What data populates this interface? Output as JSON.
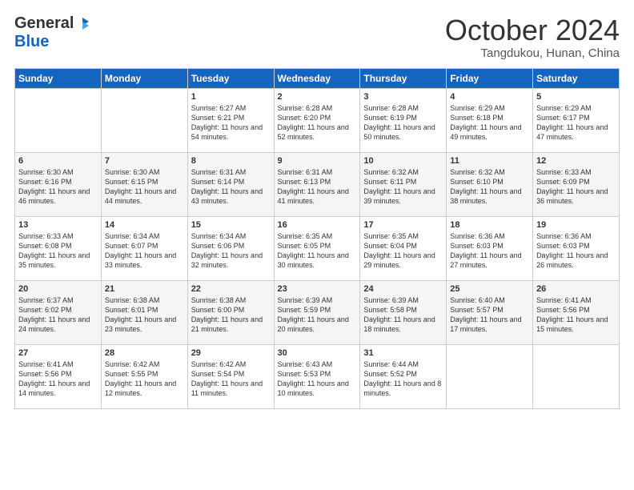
{
  "header": {
    "logo_general": "General",
    "logo_blue": "Blue",
    "title": "October 2024",
    "location": "Tangdukou, Hunan, China"
  },
  "days_of_week": [
    "Sunday",
    "Monday",
    "Tuesday",
    "Wednesday",
    "Thursday",
    "Friday",
    "Saturday"
  ],
  "weeks": [
    [
      {
        "day": "",
        "sunrise": "",
        "sunset": "",
        "daylight": ""
      },
      {
        "day": "",
        "sunrise": "",
        "sunset": "",
        "daylight": ""
      },
      {
        "day": "1",
        "sunrise": "Sunrise: 6:27 AM",
        "sunset": "Sunset: 6:21 PM",
        "daylight": "Daylight: 11 hours and 54 minutes."
      },
      {
        "day": "2",
        "sunrise": "Sunrise: 6:28 AM",
        "sunset": "Sunset: 6:20 PM",
        "daylight": "Daylight: 11 hours and 52 minutes."
      },
      {
        "day": "3",
        "sunrise": "Sunrise: 6:28 AM",
        "sunset": "Sunset: 6:19 PM",
        "daylight": "Daylight: 11 hours and 50 minutes."
      },
      {
        "day": "4",
        "sunrise": "Sunrise: 6:29 AM",
        "sunset": "Sunset: 6:18 PM",
        "daylight": "Daylight: 11 hours and 49 minutes."
      },
      {
        "day": "5",
        "sunrise": "Sunrise: 6:29 AM",
        "sunset": "Sunset: 6:17 PM",
        "daylight": "Daylight: 11 hours and 47 minutes."
      }
    ],
    [
      {
        "day": "6",
        "sunrise": "Sunrise: 6:30 AM",
        "sunset": "Sunset: 6:16 PM",
        "daylight": "Daylight: 11 hours and 46 minutes."
      },
      {
        "day": "7",
        "sunrise": "Sunrise: 6:30 AM",
        "sunset": "Sunset: 6:15 PM",
        "daylight": "Daylight: 11 hours and 44 minutes."
      },
      {
        "day": "8",
        "sunrise": "Sunrise: 6:31 AM",
        "sunset": "Sunset: 6:14 PM",
        "daylight": "Daylight: 11 hours and 43 minutes."
      },
      {
        "day": "9",
        "sunrise": "Sunrise: 6:31 AM",
        "sunset": "Sunset: 6:13 PM",
        "daylight": "Daylight: 11 hours and 41 minutes."
      },
      {
        "day": "10",
        "sunrise": "Sunrise: 6:32 AM",
        "sunset": "Sunset: 6:11 PM",
        "daylight": "Daylight: 11 hours and 39 minutes."
      },
      {
        "day": "11",
        "sunrise": "Sunrise: 6:32 AM",
        "sunset": "Sunset: 6:10 PM",
        "daylight": "Daylight: 11 hours and 38 minutes."
      },
      {
        "day": "12",
        "sunrise": "Sunrise: 6:33 AM",
        "sunset": "Sunset: 6:09 PM",
        "daylight": "Daylight: 11 hours and 36 minutes."
      }
    ],
    [
      {
        "day": "13",
        "sunrise": "Sunrise: 6:33 AM",
        "sunset": "Sunset: 6:08 PM",
        "daylight": "Daylight: 11 hours and 35 minutes."
      },
      {
        "day": "14",
        "sunrise": "Sunrise: 6:34 AM",
        "sunset": "Sunset: 6:07 PM",
        "daylight": "Daylight: 11 hours and 33 minutes."
      },
      {
        "day": "15",
        "sunrise": "Sunrise: 6:34 AM",
        "sunset": "Sunset: 6:06 PM",
        "daylight": "Daylight: 11 hours and 32 minutes."
      },
      {
        "day": "16",
        "sunrise": "Sunrise: 6:35 AM",
        "sunset": "Sunset: 6:05 PM",
        "daylight": "Daylight: 11 hours and 30 minutes."
      },
      {
        "day": "17",
        "sunrise": "Sunrise: 6:35 AM",
        "sunset": "Sunset: 6:04 PM",
        "daylight": "Daylight: 11 hours and 29 minutes."
      },
      {
        "day": "18",
        "sunrise": "Sunrise: 6:36 AM",
        "sunset": "Sunset: 6:03 PM",
        "daylight": "Daylight: 11 hours and 27 minutes."
      },
      {
        "day": "19",
        "sunrise": "Sunrise: 6:36 AM",
        "sunset": "Sunset: 6:03 PM",
        "daylight": "Daylight: 11 hours and 26 minutes."
      }
    ],
    [
      {
        "day": "20",
        "sunrise": "Sunrise: 6:37 AM",
        "sunset": "Sunset: 6:02 PM",
        "daylight": "Daylight: 11 hours and 24 minutes."
      },
      {
        "day": "21",
        "sunrise": "Sunrise: 6:38 AM",
        "sunset": "Sunset: 6:01 PM",
        "daylight": "Daylight: 11 hours and 23 minutes."
      },
      {
        "day": "22",
        "sunrise": "Sunrise: 6:38 AM",
        "sunset": "Sunset: 6:00 PM",
        "daylight": "Daylight: 11 hours and 21 minutes."
      },
      {
        "day": "23",
        "sunrise": "Sunrise: 6:39 AM",
        "sunset": "Sunset: 5:59 PM",
        "daylight": "Daylight: 11 hours and 20 minutes."
      },
      {
        "day": "24",
        "sunrise": "Sunrise: 6:39 AM",
        "sunset": "Sunset: 5:58 PM",
        "daylight": "Daylight: 11 hours and 18 minutes."
      },
      {
        "day": "25",
        "sunrise": "Sunrise: 6:40 AM",
        "sunset": "Sunset: 5:57 PM",
        "daylight": "Daylight: 11 hours and 17 minutes."
      },
      {
        "day": "26",
        "sunrise": "Sunrise: 6:41 AM",
        "sunset": "Sunset: 5:56 PM",
        "daylight": "Daylight: 11 hours and 15 minutes."
      }
    ],
    [
      {
        "day": "27",
        "sunrise": "Sunrise: 6:41 AM",
        "sunset": "Sunset: 5:56 PM",
        "daylight": "Daylight: 11 hours and 14 minutes."
      },
      {
        "day": "28",
        "sunrise": "Sunrise: 6:42 AM",
        "sunset": "Sunset: 5:55 PM",
        "daylight": "Daylight: 11 hours and 12 minutes."
      },
      {
        "day": "29",
        "sunrise": "Sunrise: 6:42 AM",
        "sunset": "Sunset: 5:54 PM",
        "daylight": "Daylight: 11 hours and 11 minutes."
      },
      {
        "day": "30",
        "sunrise": "Sunrise: 6:43 AM",
        "sunset": "Sunset: 5:53 PM",
        "daylight": "Daylight: 11 hours and 10 minutes."
      },
      {
        "day": "31",
        "sunrise": "Sunrise: 6:44 AM",
        "sunset": "Sunset: 5:52 PM",
        "daylight": "Daylight: 11 hours and 8 minutes."
      },
      {
        "day": "",
        "sunrise": "",
        "sunset": "",
        "daylight": ""
      },
      {
        "day": "",
        "sunrise": "",
        "sunset": "",
        "daylight": ""
      }
    ]
  ]
}
